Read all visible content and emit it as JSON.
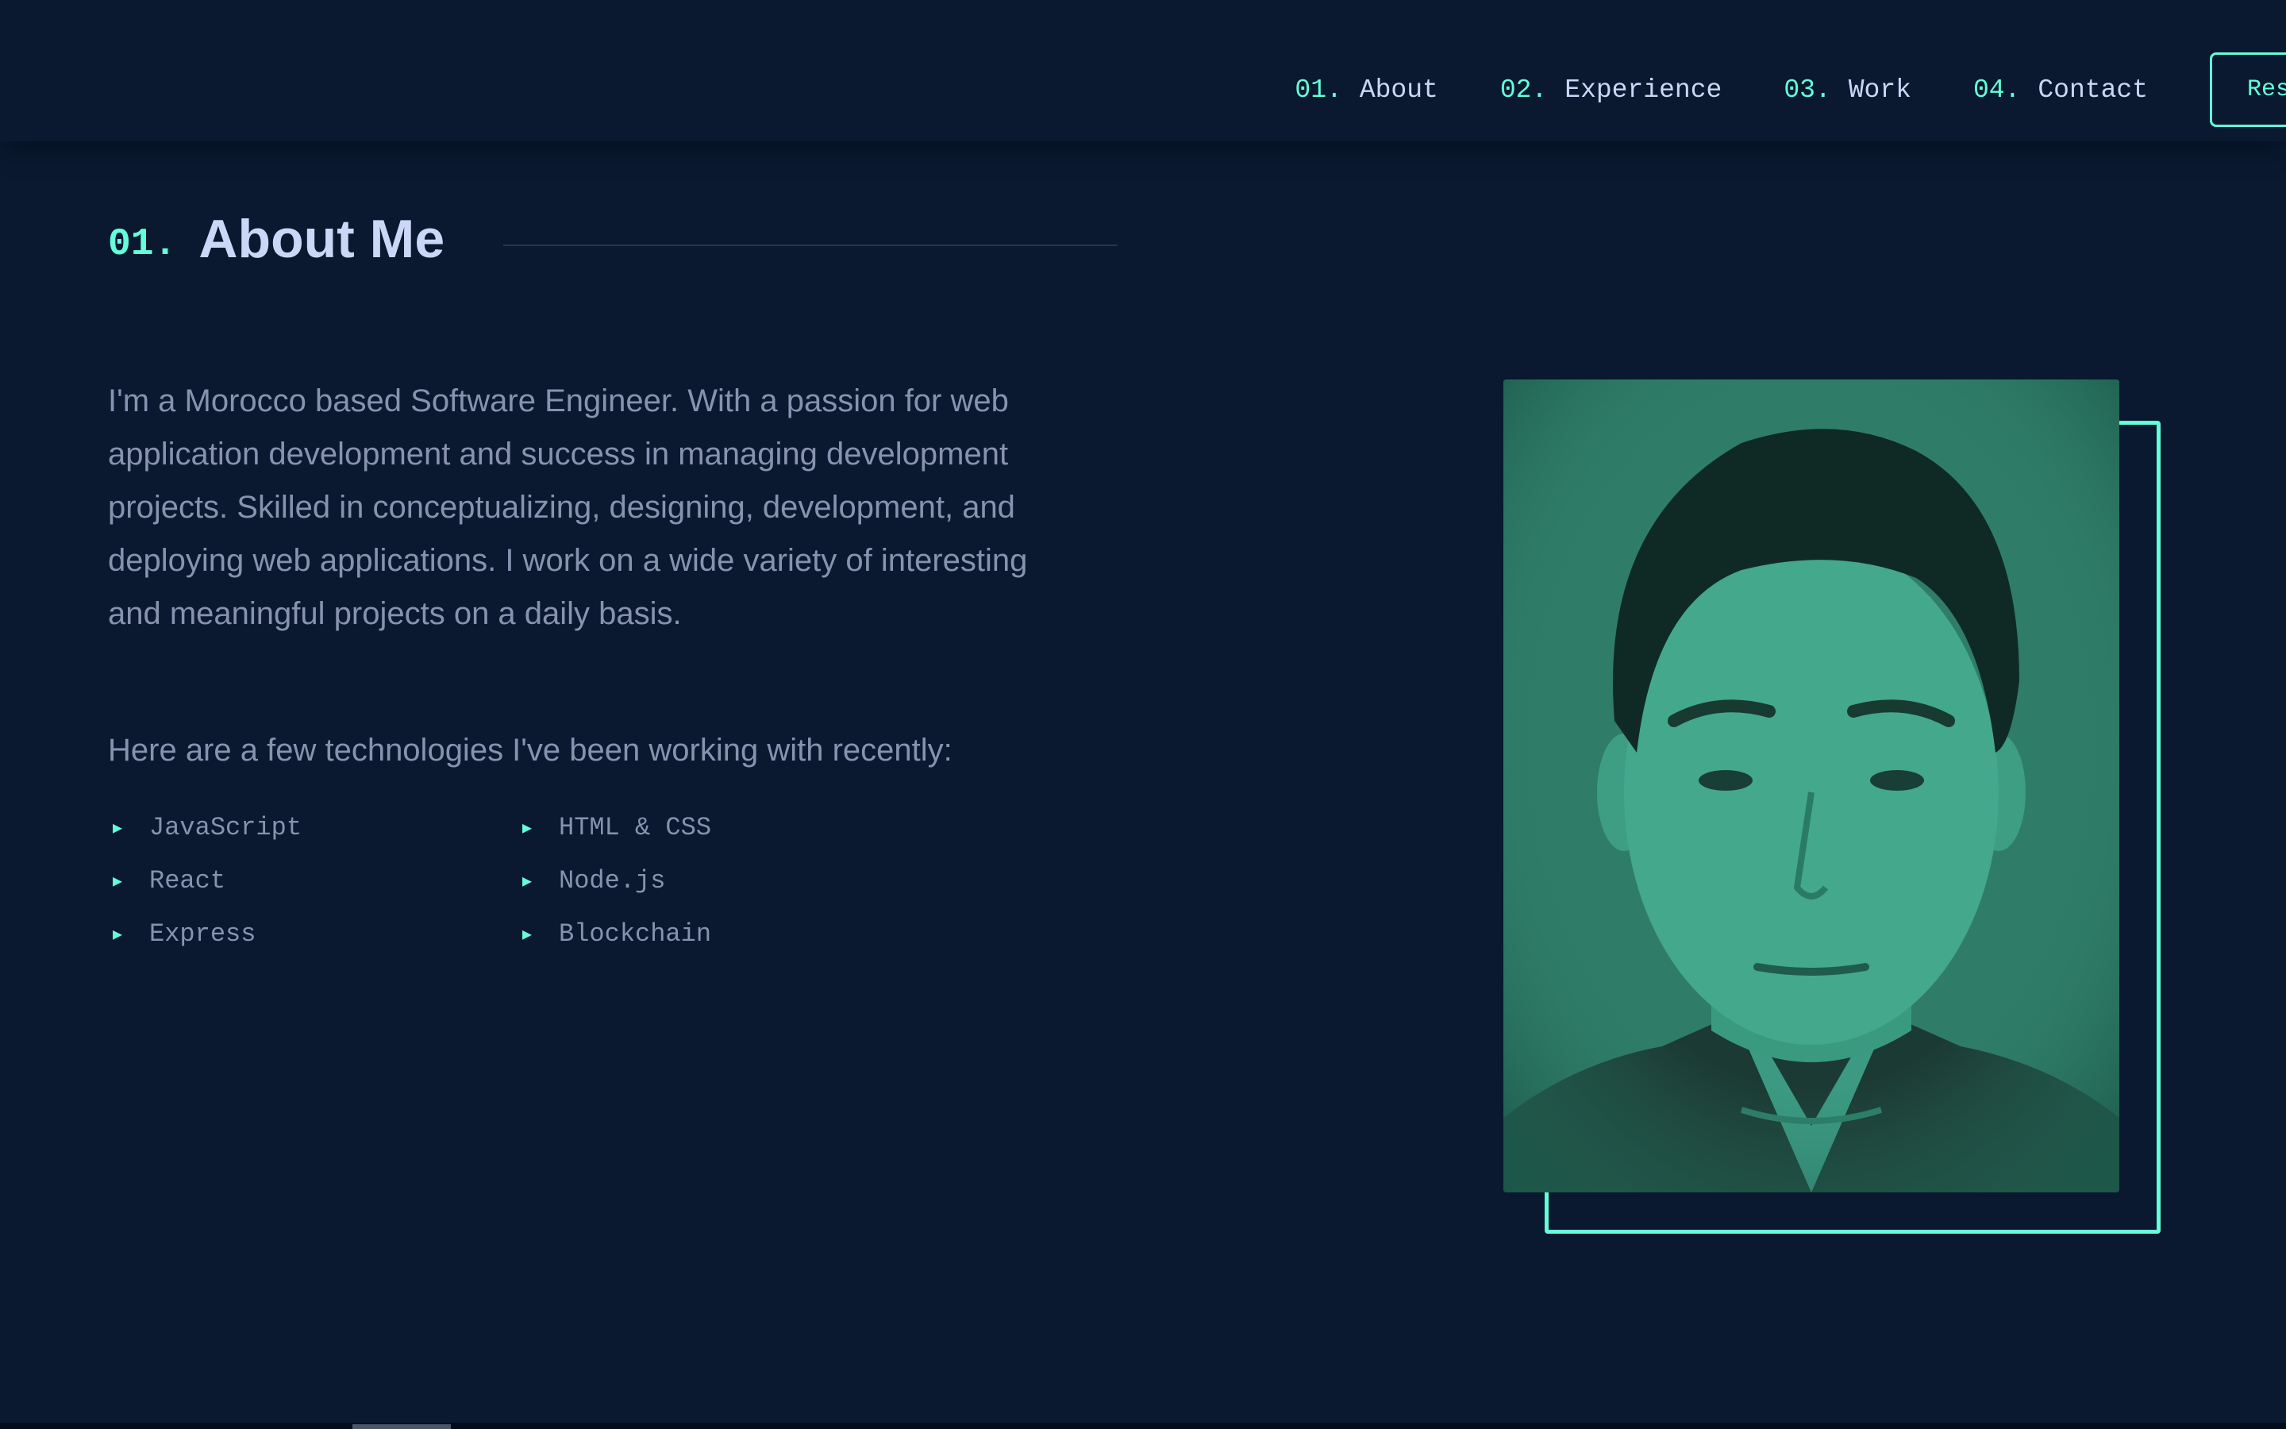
{
  "nav": {
    "items": [
      {
        "num": "01.",
        "label": "About"
      },
      {
        "num": "02.",
        "label": "Experience"
      },
      {
        "num": "03.",
        "label": "Work"
      },
      {
        "num": "04.",
        "label": "Contact"
      }
    ],
    "resume_label": "Resume"
  },
  "about": {
    "heading_num": "01.",
    "heading_title": "About Me",
    "bio": "I'm a Morocco based Software Engineer. With a passion for web application development and success in managing development projects. Skilled in conceptualizing, designing, development, and deploying web applications. I work on a wide variety of interesting and meaningful projects on a daily basis.",
    "tech_intro": "Here are a few technologies I've been working with recently:",
    "skills": [
      "JavaScript",
      "HTML & CSS",
      "React",
      "Node.js",
      "Express",
      "Blockchain"
    ],
    "bullet": "▶"
  },
  "colors": {
    "background": "#0a192f",
    "accent": "#64ffda",
    "text": "#8892b0",
    "heading": "#ccd6f6",
    "photo_tint": "#2f7d69"
  }
}
